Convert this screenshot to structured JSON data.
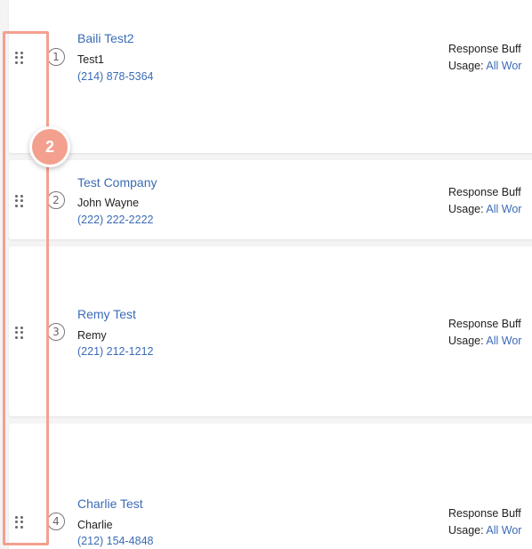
{
  "rows": [
    {
      "number": "1",
      "company": "Baili Test2",
      "contact": "Test1",
      "phone": "(214) 878-5364",
      "response_label": "Response Buff",
      "usage_label": "Usage:",
      "usage_value": "All Wor"
    },
    {
      "number": "2",
      "company": "Test Company",
      "contact": "John Wayne",
      "phone": "(222) 222-2222",
      "response_label": "Response Buff",
      "usage_label": "Usage:",
      "usage_value": "All Wor"
    },
    {
      "number": "3",
      "company": "Remy Test",
      "contact": "Remy",
      "phone": "(221) 212-1212",
      "response_label": "Response Buff",
      "usage_label": "Usage:",
      "usage_value": "All Wor"
    },
    {
      "number": "4",
      "company": "Charlie Test",
      "contact": "Charlie",
      "phone": "(212) 154-4848",
      "response_label": "Response Buff",
      "usage_label": "Usage:",
      "usage_value": "All Wor"
    }
  ],
  "callout": {
    "step": "2"
  },
  "colors": {
    "accent": "#f4a08e",
    "link": "#3b6bb5"
  }
}
